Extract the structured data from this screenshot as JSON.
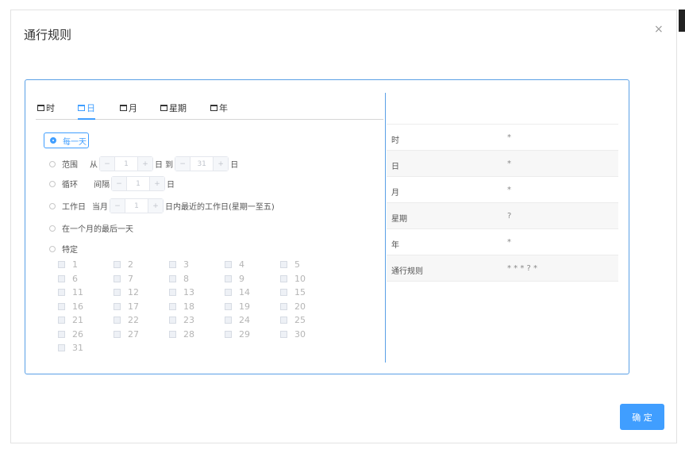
{
  "dialog": {
    "title": "通行规则",
    "close_symbol": "×",
    "ok_label": "确 定"
  },
  "tabs": [
    {
      "label": "时"
    },
    {
      "label": "日",
      "active": true
    },
    {
      "label": "月"
    },
    {
      "label": "星期"
    },
    {
      "label": "年"
    }
  ],
  "day_options": {
    "every_day": "每一天",
    "range": {
      "label": "范围",
      "from": "从",
      "start_value": "1",
      "middle": "日 到",
      "end_value": "31",
      "suffix": "日"
    },
    "loop": {
      "label": "循环",
      "interval": "间隔",
      "value": "1",
      "suffix": "日"
    },
    "workday": {
      "label": "工作日",
      "prefix": "当月",
      "value": "1",
      "suffix": "日内最近的工作日(星期一至五)"
    },
    "last_day": "在一个月的最后一天",
    "specific": {
      "label": "特定",
      "days": [
        "1",
        "2",
        "3",
        "4",
        "5",
        "6",
        "7",
        "8",
        "9",
        "10",
        "11",
        "12",
        "13",
        "14",
        "15",
        "16",
        "17",
        "18",
        "19",
        "20",
        "21",
        "22",
        "23",
        "24",
        "25",
        "26",
        "27",
        "28",
        "29",
        "30",
        "31"
      ]
    },
    "minus": "−",
    "plus": "+"
  },
  "summary": {
    "rows": [
      {
        "key": "时",
        "value": "*"
      },
      {
        "key": "日",
        "value": "*"
      },
      {
        "key": "月",
        "value": "*"
      },
      {
        "key": "星期",
        "value": "?"
      },
      {
        "key": "年",
        "value": "*"
      },
      {
        "key": "通行规则",
        "value": "* * * ? *"
      }
    ]
  },
  "colors": {
    "accent": "#409eff",
    "frame": "#5aa0e6"
  }
}
